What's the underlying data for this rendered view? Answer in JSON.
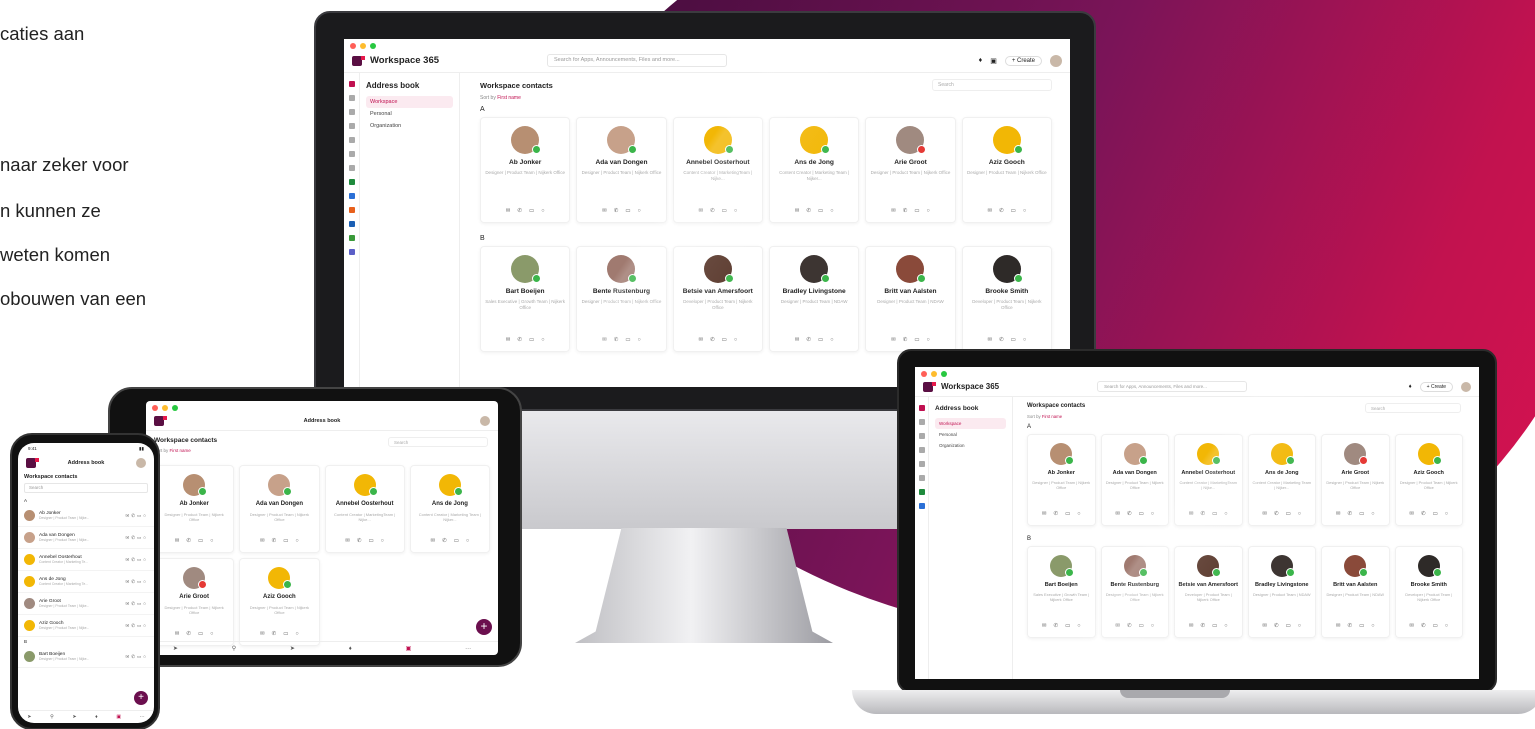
{
  "background_text": [
    "caties aan",
    "naar zeker voor",
    "n kunnen ze",
    "weten komen",
    "obouwen van een"
  ],
  "app": {
    "name": "Workspace 365",
    "search_placeholder": "Search for Apps, Announcements, Files and more...",
    "create_label": "+ Create",
    "nav": {
      "title": "Address book",
      "items": [
        "Workspace",
        "Personal",
        "Organization"
      ]
    },
    "main": {
      "title": "Workspace contacts",
      "sort_prefix": "Sort by",
      "sort_value": "First name",
      "search_placeholder": "Search",
      "group_a": "A",
      "group_b": "B"
    }
  },
  "contacts_a": [
    {
      "name": "Ab Jonker",
      "role": "Designer | Product Team | Nijkerk Office",
      "color": "#b78f72",
      "status": "available"
    },
    {
      "name": "Ada van Dongen",
      "role": "Designer | Product Team | Nijkerk Office",
      "color": "#c7a18a",
      "status": "available"
    },
    {
      "name": "Annebel Oosterhout",
      "role": "Content Creator | MarketingTeam | Nijke...",
      "color": "#f2b705",
      "status": "available"
    },
    {
      "name": "Ans de Jong",
      "role": "Content Creator | Marketing Team | Nijker...",
      "color": "#f2b705",
      "status": "available"
    },
    {
      "name": "Arie Groot",
      "role": "Designer | Product Team | Nijkerk Office",
      "color": "#a08a80",
      "status": "busy"
    },
    {
      "name": "Aziz Gooch",
      "role": "Designer | Product Team | Nijkerk Office",
      "color": "#f2b705",
      "status": "available"
    }
  ],
  "contacts_b": [
    {
      "name": "Bart Boeijen",
      "role": "Sales Executive | Growth Team | Nijkerk Office",
      "color": "#8a9a6a",
      "status": "available"
    },
    {
      "name": "Bente Rustenburg",
      "role": "Designer | Product Team | Nijkerk Office",
      "color": "#a07a70",
      "status": "available"
    },
    {
      "name": "Betsie van Amersfoort",
      "role": "Developer | Product Team | Nijkerk Office",
      "color": "#5b3a2e",
      "status": "away"
    },
    {
      "name": "Bradley Livingstone",
      "role": "Designer | Product Team | NDAW",
      "color": "#3d3532",
      "status": "available"
    },
    {
      "name": "Britt van Aalsten",
      "role": "Designer | Product Team | NDAW",
      "color": "#8a4a3a",
      "status": "available"
    },
    {
      "name": "Brooke Smith",
      "role": "Developer | Product Team | Nijkerk Office",
      "color": "#2e2a28",
      "status": "available"
    }
  ],
  "mobile": {
    "title": "Address book",
    "list_title": "Workspace contacts",
    "search_placeholder": "Search",
    "time": "9:41",
    "list": [
      "Ab Jonker",
      "Ada van Dongen",
      "Annebel Oosterhout",
      "Ans de Jong",
      "Arie Groot",
      "Aziz Gooch",
      "Bart Boeijen"
    ],
    "list_roles": [
      "Designer | Product Team | Nijke...",
      "Designer | Product Team | Nijke...",
      "Content Creator | Marketing Te...",
      "Content Creator | Marketing Te...",
      "Designer | Product Team | Nijke...",
      "Designer | Product Team | Nijke...",
      "Designer | Product Team | Nijke..."
    ]
  },
  "colors": {
    "accent": "#c01050",
    "brand": "#5a0f43",
    "available": "#3bb54a",
    "busy": "#e53935"
  }
}
